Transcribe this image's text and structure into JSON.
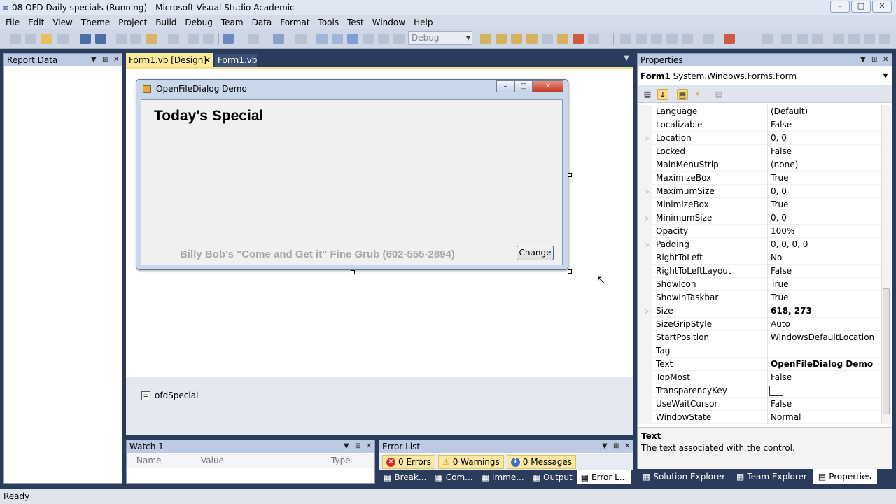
{
  "window": {
    "title": "08 OFD Daily specials (Running) - Microsoft Visual Studio Academic",
    "logo": "∞"
  },
  "menu": [
    "File",
    "Edit",
    "View",
    "Theme",
    "Project",
    "Build",
    "Debug",
    "Team",
    "Data",
    "Format",
    "Tools",
    "Test",
    "Window",
    "Help"
  ],
  "toolbar": {
    "config_combo": "Debug"
  },
  "left_panel": {
    "title": "Report Data"
  },
  "doc_tabs": {
    "active": "Form1.vb [Design]",
    "other": "Form1.vb"
  },
  "form": {
    "title": "OpenFileDialog Demo",
    "heading": "Today's Special",
    "footer": "Billy Bob's \"Come and Get it\" Fine Grub  (602-555-2894)",
    "button": "Change"
  },
  "tray": {
    "component": "ofdSpecial"
  },
  "properties": {
    "title": "Properties",
    "object_name": "Form1",
    "object_type": "System.Windows.Forms.Form",
    "rows": [
      {
        "name": "Language",
        "value": "(Default)",
        "exp": false,
        "bold": false
      },
      {
        "name": "Localizable",
        "value": "False",
        "exp": false,
        "bold": false
      },
      {
        "name": "Location",
        "value": "0, 0",
        "exp": true,
        "bold": false
      },
      {
        "name": "Locked",
        "value": "False",
        "exp": false,
        "bold": false
      },
      {
        "name": "MainMenuStrip",
        "value": "(none)",
        "exp": false,
        "bold": false
      },
      {
        "name": "MaximizeBox",
        "value": "True",
        "exp": false,
        "bold": false
      },
      {
        "name": "MaximumSize",
        "value": "0, 0",
        "exp": true,
        "bold": false
      },
      {
        "name": "MinimizeBox",
        "value": "True",
        "exp": false,
        "bold": false
      },
      {
        "name": "MinimumSize",
        "value": "0, 0",
        "exp": true,
        "bold": false
      },
      {
        "name": "Opacity",
        "value": "100%",
        "exp": false,
        "bold": false
      },
      {
        "name": "Padding",
        "value": "0, 0, 0, 0",
        "exp": true,
        "bold": false
      },
      {
        "name": "RightToLeft",
        "value": "No",
        "exp": false,
        "bold": false
      },
      {
        "name": "RightToLeftLayout",
        "value": "False",
        "exp": false,
        "bold": false
      },
      {
        "name": "ShowIcon",
        "value": "True",
        "exp": false,
        "bold": false
      },
      {
        "name": "ShowInTaskbar",
        "value": "True",
        "exp": false,
        "bold": false
      },
      {
        "name": "Size",
        "value": "618, 273",
        "exp": true,
        "bold": true
      },
      {
        "name": "SizeGripStyle",
        "value": "Auto",
        "exp": false,
        "bold": false
      },
      {
        "name": "StartPosition",
        "value": "WindowsDefaultLocation",
        "exp": false,
        "bold": false
      },
      {
        "name": "Tag",
        "value": "",
        "exp": false,
        "bold": false
      },
      {
        "name": "Text",
        "value": "OpenFileDialog Demo",
        "exp": false,
        "bold": true
      },
      {
        "name": "TopMost",
        "value": "False",
        "exp": false,
        "bold": false
      },
      {
        "name": "TransparencyKey",
        "value": "",
        "exp": false,
        "bold": false,
        "swatch": true
      },
      {
        "name": "UseWaitCursor",
        "value": "False",
        "exp": false,
        "bold": false
      },
      {
        "name": "WindowState",
        "value": "Normal",
        "exp": false,
        "bold": false
      }
    ],
    "desc_title": "Text",
    "desc_text": "The text associated with the control."
  },
  "bottom_right_tabs": [
    "Solution Explorer",
    "Team Explorer",
    "Properties"
  ],
  "watch": {
    "title": "Watch 1",
    "cols": [
      "Name",
      "Value",
      "Type"
    ]
  },
  "error_list": {
    "title": "Error List",
    "errors": "0 Errors",
    "warnings": "0 Warnings",
    "messages": "0 Messages",
    "tabs": [
      "Break...",
      "Com...",
      "Imme...",
      "Output",
      "Error L..."
    ]
  },
  "status": {
    "text": "Ready"
  },
  "colors": {
    "accent_tab": "#f9e99a",
    "chrome": "#2b3b5c"
  }
}
